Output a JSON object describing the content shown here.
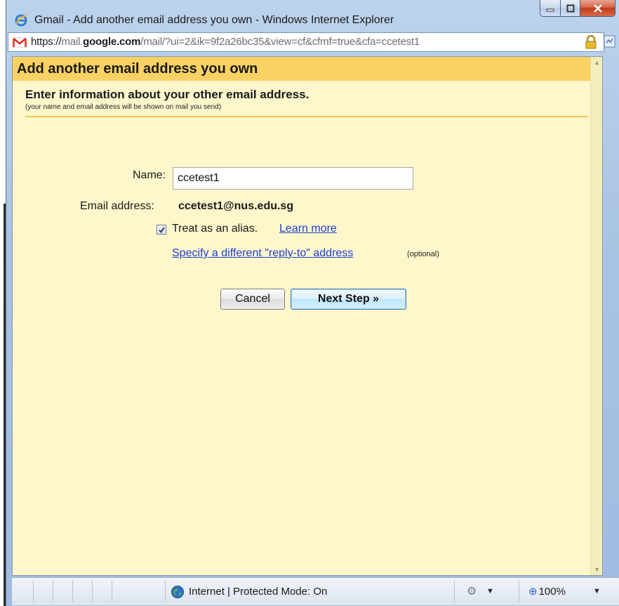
{
  "window": {
    "title": "Gmail - Add another email address you own - Windows Internet Explorer"
  },
  "address_bar": {
    "url_scheme": "https://",
    "url_prefix": "mail.",
    "url_domain": "google.com",
    "url_path": "/mail/?ui=2&ik=9f2a26bc35&view=cf&cfmf=true&cfa=ccetest1"
  },
  "dialog": {
    "heading": "Add another email address you own",
    "subheading": "Enter information about your other email address.",
    "note": "(your name and email address will be shown on mail you send)",
    "name_label": "Name:",
    "name_value": "ccetest1",
    "email_label": "Email address:",
    "email_value": "ccetest1@nus.edu.sg",
    "alias_checked": true,
    "alias_label": "Treat as an alias.",
    "learn_more": "Learn more",
    "reply_to_link": "Specify a different \"reply-to\" address",
    "optional": "(optional)",
    "cancel_button": "Cancel",
    "next_button": "Next Step »"
  },
  "status_bar": {
    "zone": "Internet | Protected Mode: On",
    "zoom": "100%"
  },
  "colors": {
    "header_band": "#fad163",
    "content_bg": "#fff7cc",
    "link": "#1a3ed6"
  }
}
